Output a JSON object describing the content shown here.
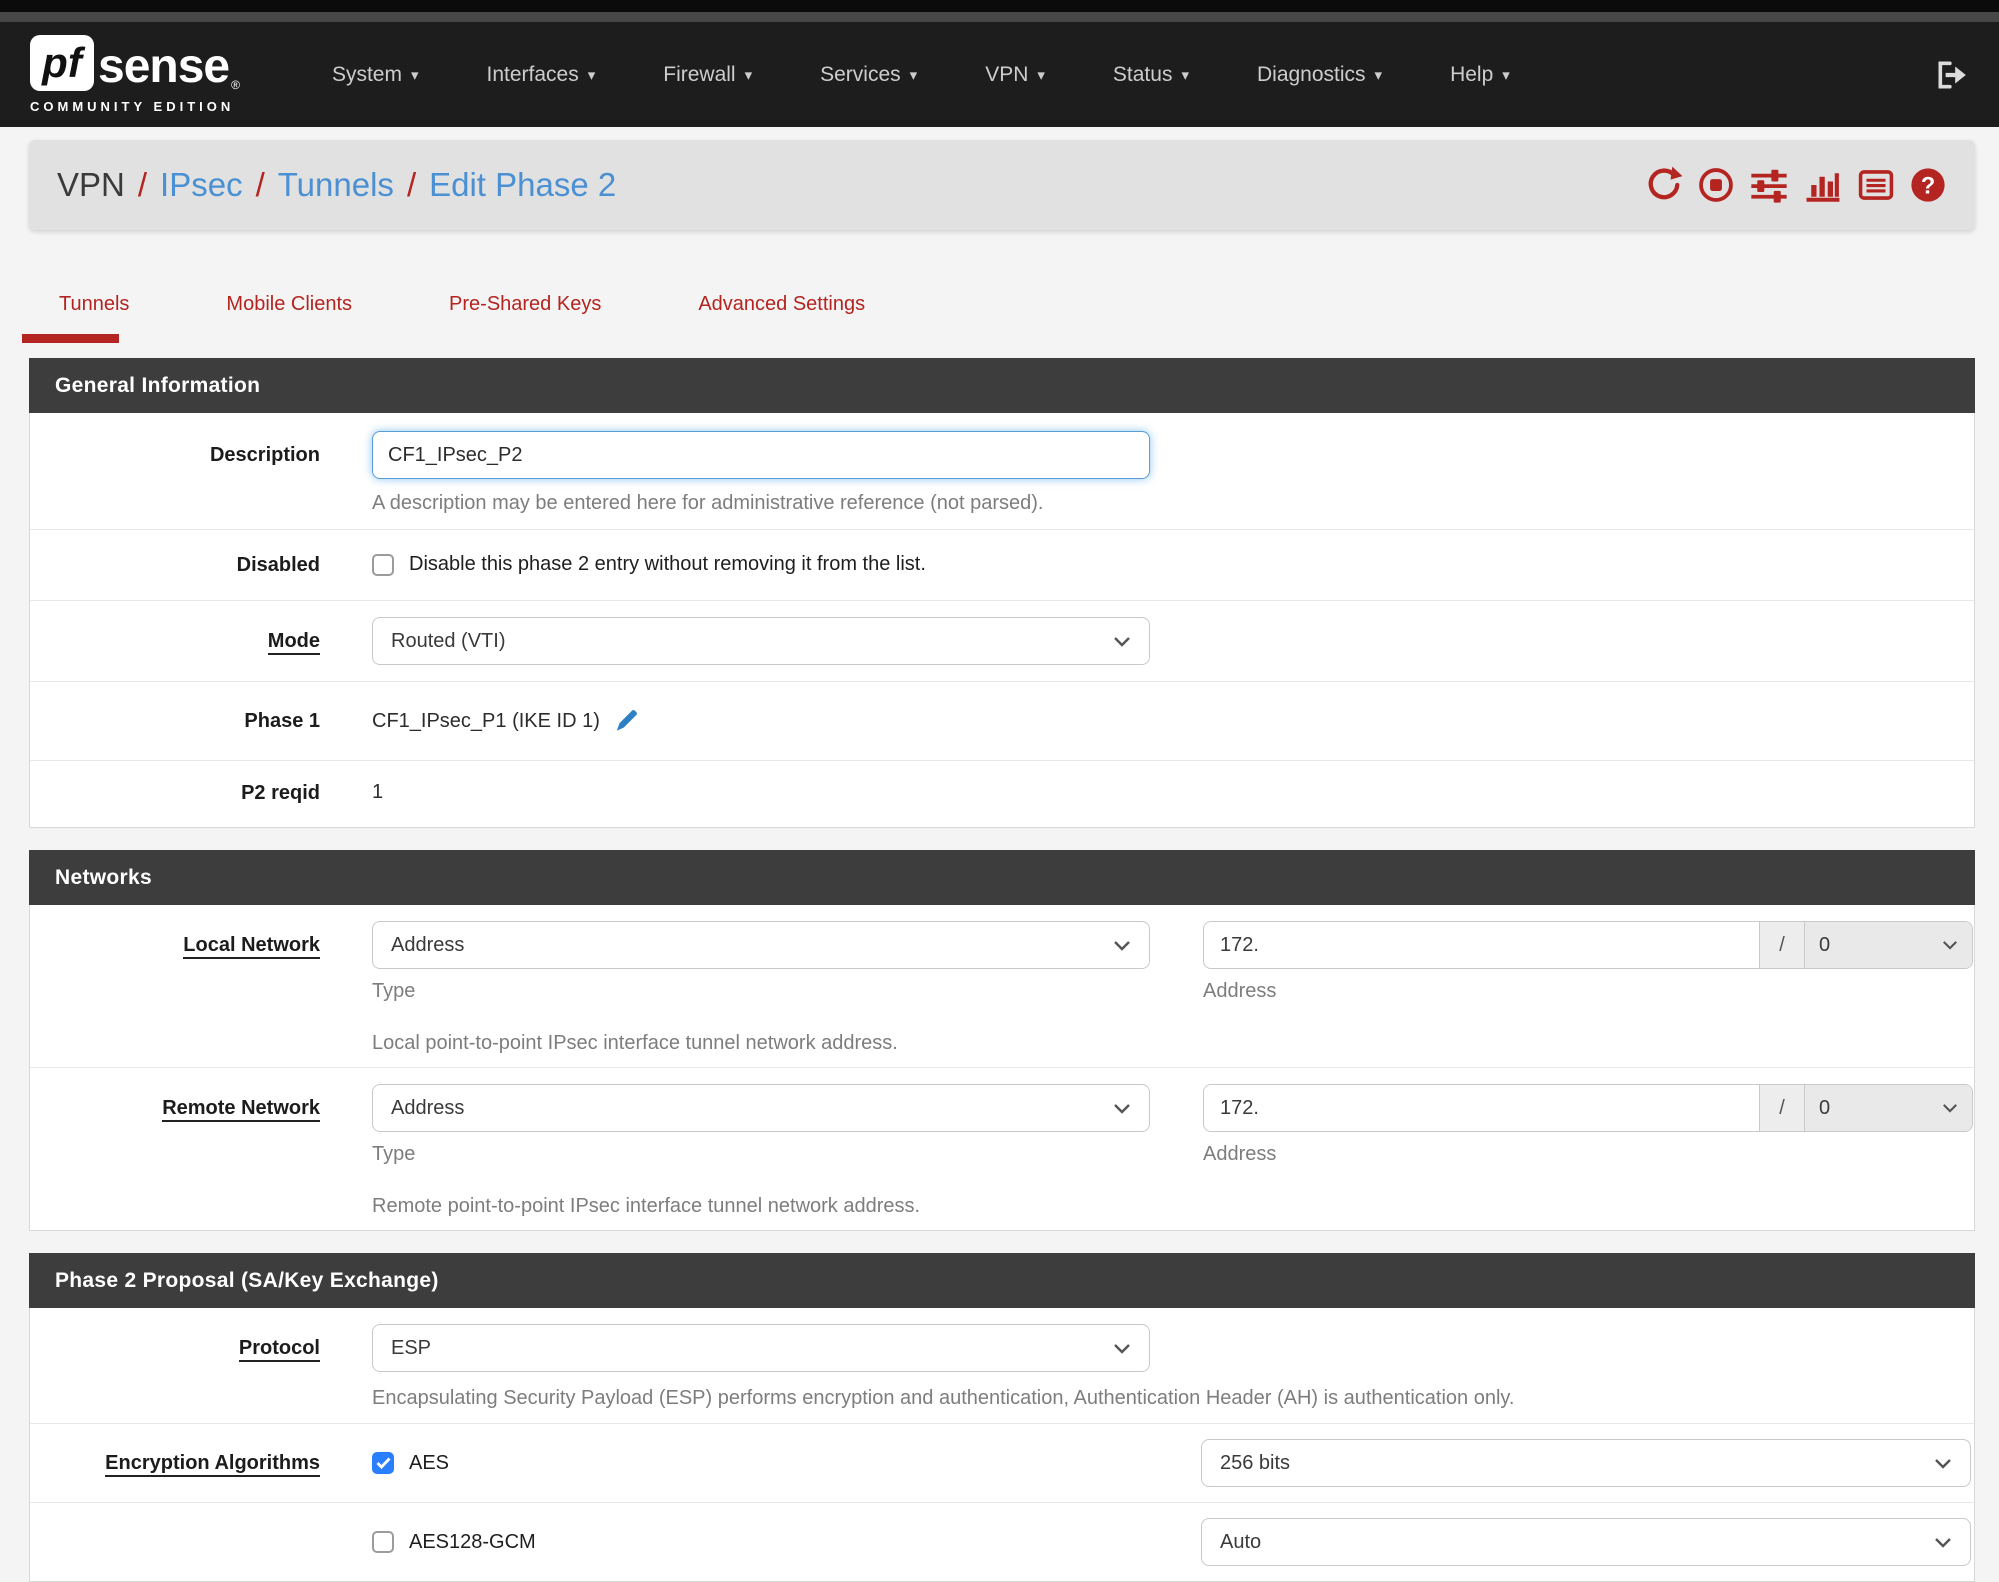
{
  "navbar": {
    "brand_pf": "pf",
    "brand_sense": "sense",
    "brand_reg": "®",
    "brand_edition": "COMMUNITY EDITION",
    "items": [
      {
        "label": "System"
      },
      {
        "label": "Interfaces"
      },
      {
        "label": "Firewall"
      },
      {
        "label": "Services"
      },
      {
        "label": "VPN"
      },
      {
        "label": "Status"
      },
      {
        "label": "Diagnostics"
      },
      {
        "label": "Help"
      }
    ],
    "icons": [
      "chevron-down-icon",
      "sign-out-icon"
    ]
  },
  "breadcrumb": {
    "root": "VPN",
    "sep": "/",
    "link1": "IPsec",
    "link2": "Tunnels",
    "link3": "Edit Phase 2",
    "icons": [
      "refresh-icon",
      "stop-icon",
      "sliders-icon",
      "chart-icon",
      "log-icon",
      "help-icon"
    ]
  },
  "tabs": [
    {
      "label": "Tunnels",
      "active": true
    },
    {
      "label": "Mobile Clients",
      "active": false
    },
    {
      "label": "Pre-Shared Keys",
      "active": false
    },
    {
      "label": "Advanced Settings",
      "active": false
    }
  ],
  "general": {
    "title": "General Information",
    "description_label": "Description",
    "description_value": "CF1_IPsec_P2",
    "description_help": "A description may be entered here for administrative reference (not parsed).",
    "disabled_label": "Disabled",
    "disabled_text": "Disable this phase 2 entry without removing it from the list.",
    "disabled_checked": false,
    "mode_label": "Mode",
    "mode_value": "Routed (VTI)",
    "phase1_label": "Phase 1",
    "phase1_value": "CF1_IPsec_P1 (IKE ID 1)",
    "phase1_edit_icon": "pencil-icon",
    "p2reqid_label": "P2 reqid",
    "p2reqid_value": "1"
  },
  "networks": {
    "title": "Networks",
    "local_label": "Local Network",
    "remote_label": "Remote Network",
    "type_value": "Address",
    "type_help": "Type",
    "address_value": "172.",
    "address_help": "Address",
    "slash": "/",
    "prefix_value": "0",
    "local_help": "Local point-to-point IPsec interface tunnel network address.",
    "remote_help": "Remote point-to-point IPsec interface tunnel network address."
  },
  "proposal": {
    "title": "Phase 2 Proposal (SA/Key Exchange)",
    "protocol_label": "Protocol",
    "protocol_value": "ESP",
    "protocol_help": "Encapsulating Security Payload (ESP) performs encryption and authentication, Authentication Header (AH) is authentication only.",
    "enc_label": "Encryption Algorithms",
    "algorithms": [
      {
        "name": "AES",
        "checked": true,
        "bits": "256 bits"
      },
      {
        "name": "AES128-GCM",
        "checked": false,
        "bits": "Auto"
      }
    ]
  },
  "colors": {
    "accent_red": "#b42420",
    "link_blue": "#4a90d2",
    "navbar_bg": "#1d1d1d",
    "panel_header_bg": "#3d3d3d",
    "checkbox_blue": "#2a7fff",
    "breadcrumb_bg": "#e2e1e1"
  }
}
